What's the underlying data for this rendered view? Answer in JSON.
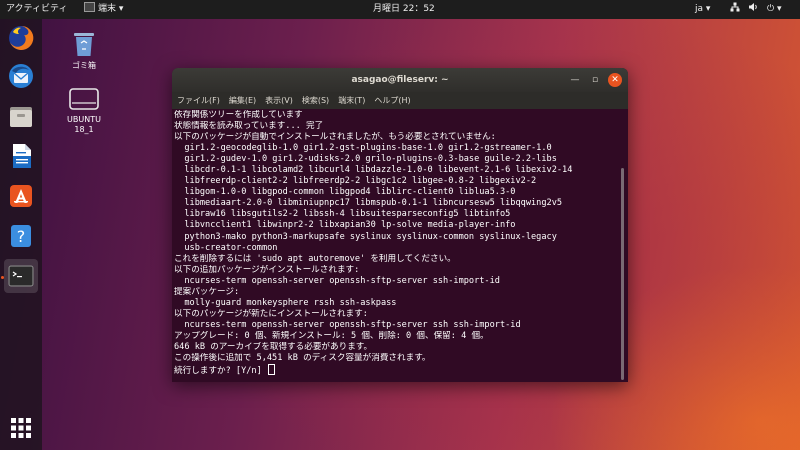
{
  "topbar": {
    "activities": "アクティビティ",
    "app_menu": "端末 ▾",
    "clock": "月曜日 22：52",
    "lang": "ja ▾",
    "system": "⏻ ▾"
  },
  "desktop": {
    "icons": [
      {
        "label": "ゴミ箱"
      },
      {
        "label": "UBUNTU 18_1"
      }
    ]
  },
  "dock": {
    "items": [
      "firefox-icon",
      "thunderbird-icon",
      "files-icon",
      "writer-icon",
      "software-icon",
      "help-icon",
      "terminal-icon",
      "app-grid-icon"
    ],
    "accent": "#e95420"
  },
  "window": {
    "title": "asagao@fileserv: ~",
    "menu": [
      "ファイル(F)",
      "編集(E)",
      "表示(V)",
      "検索(S)",
      "端末(T)",
      "ヘルプ(H)"
    ],
    "lines": [
      "依存関係ツリーを作成しています",
      "状態情報を読み取っています... 完了",
      "以下のパッケージが自動でインストールされましたが、もう必要とされていません:",
      "  gir1.2-geocodeglib-1.0 gir1.2-gst-plugins-base-1.0 gir1.2-gstreamer-1.0",
      "  gir1.2-gudev-1.0 gir1.2-udisks-2.0 grilo-plugins-0.3-base guile-2.2-libs",
      "  libcdr-0.1-1 libcolamd2 libcurl4 libdazzle-1.0-0 libevent-2.1-6 libexiv2-14",
      "  libfreerdp-client2-2 libfreerdp2-2 libgc1c2 libgee-0.8-2 libgexiv2-2",
      "  libgom-1.0-0 libgpod-common libgpod4 liblirc-client0 liblua5.3-0",
      "  libmediaart-2.0-0 libminiupnpc17 libmspub-0.1-1 libncursesw5 libqqwing2v5",
      "  libraw16 libsgutils2-2 libssh-4 libsuitesparseconfig5 libtinfo5",
      "  libvncclient1 libwinpr2-2 libxapian30 lp-solve media-player-info",
      "  python3-mako python3-markupsafe syslinux syslinux-common syslinux-legacy",
      "  usb-creator-common",
      "これを削除するには 'sudo apt autoremove' を利用してください。",
      "以下の追加パッケージがインストールされます:",
      "  ncurses-term openssh-server openssh-sftp-server ssh-import-id",
      "提案パッケージ:",
      "  molly-guard monkeysphere rssh ssh-askpass",
      "以下のパッケージが新たにインストールされます:",
      "  ncurses-term openssh-server openssh-sftp-server ssh ssh-import-id",
      "アップグレード: 0 個、新規インストール: 5 個、削除: 0 個、保留: 4 個。",
      "646 kB のアーカイブを取得する必要があります。",
      "この操作後に追加で 5,451 kB のディスク容量が消費されます。",
      "続行しますか? [Y/n] "
    ]
  }
}
